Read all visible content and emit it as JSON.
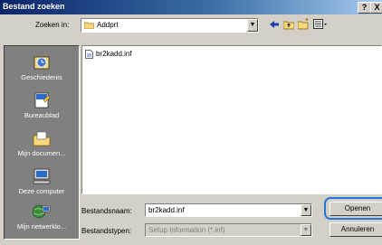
{
  "titlebar": {
    "title": "Bestand zoeken",
    "help": "?",
    "close": "X"
  },
  "lookin": {
    "label": "Zoeken in:",
    "folder": "Addprt"
  },
  "places": [
    {
      "label": "Geschiedenis",
      "icon": "history-icon"
    },
    {
      "label": "Bureaublad",
      "icon": "desktop-icon"
    },
    {
      "label": "Mijn documen...",
      "icon": "my-documents-icon"
    },
    {
      "label": "Deze computer",
      "icon": "my-computer-icon"
    },
    {
      "label": "Mijn netwerklo...",
      "icon": "my-network-icon"
    }
  ],
  "files": [
    {
      "name": "br2kadd.inf",
      "icon": "inf-file-icon"
    }
  ],
  "filename": {
    "label": "Bestandsnaam:",
    "value": "br2kadd.inf"
  },
  "filetype": {
    "label": "Bestandstypen:",
    "value": "Setup Information (*.inf)"
  },
  "buttons": {
    "open": "Openen",
    "cancel": "Annuleren"
  },
  "colors": {
    "titlebar": "#0a246a",
    "highlight_ring": "#1e78d7",
    "dialog": "#d4d0c8"
  }
}
